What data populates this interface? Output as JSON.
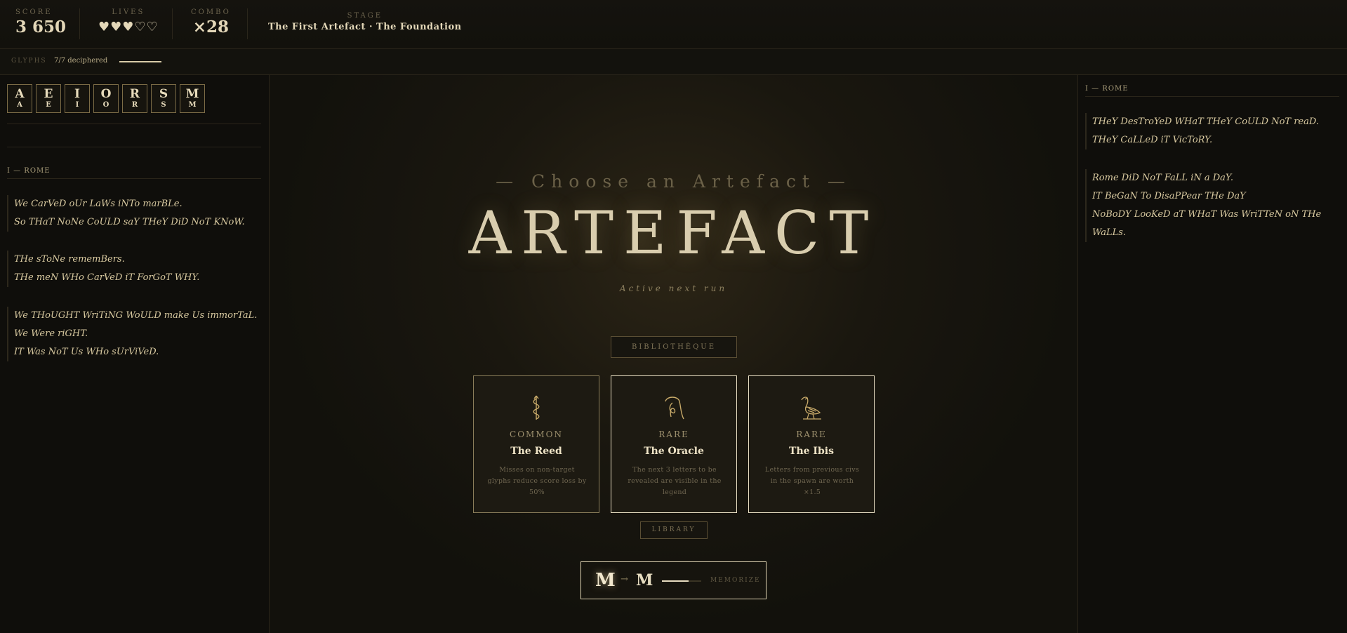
{
  "hud": {
    "score_label": "SCORE",
    "score_value": "3 650",
    "lives_label": "LIVES",
    "lives_value": "♥♥♥♡♡",
    "combo_label": "COMBO",
    "combo_value": "×28",
    "stage_label": "STAGE",
    "stage_value": "The First Artefact · The Foundation"
  },
  "glyphs": {
    "label": "GLYPHS",
    "count": "7/7 deciphered",
    "progress": 1.0
  },
  "left": {
    "tiles": [
      {
        "big": "A",
        "small": "A"
      },
      {
        "big": "E",
        "small": "E"
      },
      {
        "big": "I",
        "small": "I"
      },
      {
        "big": "O",
        "small": "O"
      },
      {
        "big": "R",
        "small": "R"
      },
      {
        "big": "S",
        "small": "S"
      },
      {
        "big": "M",
        "small": "M"
      }
    ],
    "civ": "I — ROME",
    "stanzas": [
      [
        "We CarVeD oUr LaWs iNTo marBLe.",
        "So THaT NoNe CoULD saY THeY DiD NoT KNoW."
      ],
      [
        "THe sToNe rememBers.",
        "THe meN WHo CarVeD iT ForGoT WHY."
      ],
      [
        "We THoUGHT WriTiNG WoULD make Us immorTaL.",
        "We Were riGHT.",
        "IT Was NoT Us WHo sUrViVeD."
      ]
    ]
  },
  "right": {
    "civ": "I — ROME",
    "stanzas": [
      [
        "THeY DesTroYeD WHaT THeY CoULD NoT reaD.",
        "THeY CaLLeD iT VicToRY."
      ],
      [
        "Rome DiD NoT FaLL iN a DaY.",
        "IT BeGaN To DisaPPear THe DaY",
        "NoBoDY LooKeD aT WHaT Was WriTTeN oN THe WaLLs."
      ]
    ]
  },
  "center": {
    "choose": "— Choose an Artefact —",
    "title": "ARTEFACT",
    "active": "Active next run",
    "biblio_button": "BIBLIOTHÈQUE",
    "library_button": "LIBRARY",
    "cards": [
      {
        "rarity": "COMMON",
        "name": "The Reed",
        "desc": "Misses on non-target glyphs reduce score loss by 50%",
        "icon": "reed-icon"
      },
      {
        "rarity": "RARE",
        "name": "The Oracle",
        "desc": "The next 3 letters to be revealed are visible in the legend",
        "icon": "oracle-icon"
      },
      {
        "rarity": "RARE",
        "name": "The Ibis",
        "desc": "Letters from previous civs in the spawn are worth ×1.5",
        "icon": "ibis-icon"
      }
    ],
    "memorize": {
      "glyph": "M",
      "arrow": "→",
      "letter": "M",
      "label": "MEMORIZE",
      "progress": 0.68
    }
  }
}
